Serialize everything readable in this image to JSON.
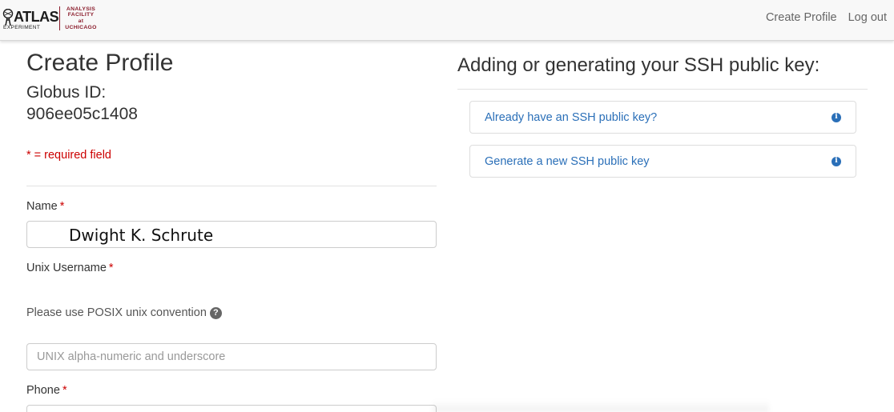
{
  "brand": {
    "atlas_word": "ATLAS",
    "atlas_sub": "EXPERIMENT",
    "af_line1": "ANALYSIS",
    "af_line2": "FACILITY",
    "af_line3": "at",
    "af_line4": "UCHICAGO",
    "accent_color": "#8a1c2b"
  },
  "nav": {
    "create_profile": "Create Profile",
    "log_out": "Log out"
  },
  "form": {
    "title": "Create Profile",
    "globus_label": "Globus ID:",
    "globus_id_tail": "906ee05c1408",
    "required_note": "* = required field",
    "required_star": "*",
    "name_label": "Name",
    "name_value": "Dwight K. Schrute",
    "unix_label": "Unix Username",
    "unix_help": "Please use POSIX unix convention",
    "unix_placeholder": "UNIX alpha-numeric and underscore",
    "phone_label": "Phone"
  },
  "ssh": {
    "title": "Adding or generating your SSH public key:",
    "panels": [
      {
        "label": "Already have an SSH public key?",
        "icon": "info-icon"
      },
      {
        "label": "Generate a new SSH public key",
        "icon": "info-icon"
      }
    ],
    "link_color": "#2a6fb8"
  },
  "colors": {
    "required": "#cc0000",
    "navbar_bg": "#f8f8f8"
  }
}
